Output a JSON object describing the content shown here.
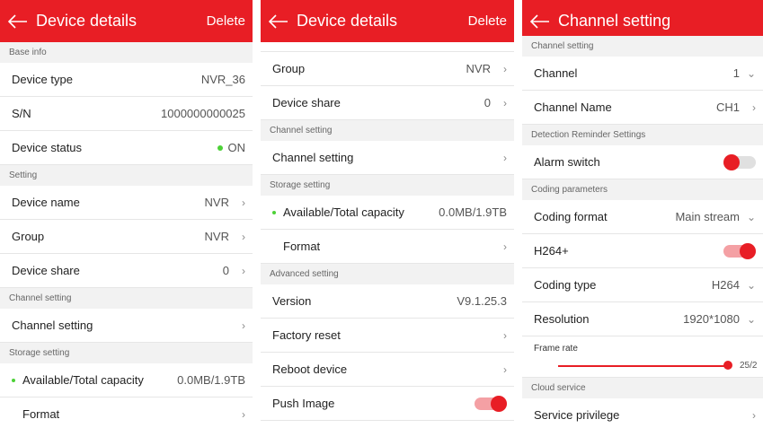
{
  "panel1": {
    "title": "Device details",
    "action": "Delete",
    "sections": {
      "base": "Base info",
      "setting": "Setting",
      "channel": "Channel setting",
      "storage": "Storage setting"
    },
    "device_type": {
      "label": "Device type",
      "value": "NVR_36"
    },
    "sn": {
      "label": "S/N",
      "value": "1000000000025"
    },
    "status": {
      "label": "Device status",
      "value": "ON"
    },
    "device_name": {
      "label": "Device name",
      "value": "NVR"
    },
    "group": {
      "label": "Group",
      "value": "NVR"
    },
    "share": {
      "label": "Device share",
      "value": "0"
    },
    "channel_setting": {
      "label": "Channel setting"
    },
    "capacity": {
      "label": "Available/Total capacity",
      "value": "0.0MB/1.9TB"
    },
    "format": {
      "label": "Format"
    }
  },
  "panel2": {
    "title": "Device details",
    "action": "Delete",
    "sections": {
      "channel": "Channel setting",
      "storage": "Storage setting",
      "advanced": "Advanced setting"
    },
    "group": {
      "label": "Group",
      "value": "NVR"
    },
    "share": {
      "label": "Device share",
      "value": "0"
    },
    "channel_setting": {
      "label": "Channel setting"
    },
    "capacity": {
      "label": "Available/Total capacity",
      "value": "0.0MB/1.9TB"
    },
    "format": {
      "label": "Format"
    },
    "version": {
      "label": "Version",
      "value": "V9.1.25.3"
    },
    "factory_reset": {
      "label": "Factory reset"
    },
    "reboot": {
      "label": "Reboot device"
    },
    "push_image": {
      "label": "Push Image",
      "on": true
    }
  },
  "panel3": {
    "title": "Channel setting",
    "sections": {
      "channel": "Channel setting",
      "detection": "Detection Reminder Settings",
      "coding": "Coding parameters",
      "cloud": "Cloud service"
    },
    "channel": {
      "label": "Channel",
      "value": "1"
    },
    "channel_name": {
      "label": "Channel Name",
      "value": "CH1"
    },
    "alarm": {
      "label": "Alarm switch",
      "on": false
    },
    "coding_format": {
      "label": "Coding format",
      "value": "Main stream"
    },
    "h264plus": {
      "label": "H264+",
      "on": true
    },
    "coding_type": {
      "label": "Coding type",
      "value": "H264"
    },
    "resolution": {
      "label": "Resolution",
      "value": "1920*1080"
    },
    "frame_rate": {
      "label": "Frame rate",
      "value": "25/2"
    },
    "service": {
      "label": "Service privilege"
    }
  },
  "colors": {
    "accent": "#e81e25",
    "online": "#4cd137"
  },
  "icons": {
    "back": "arrow-left-icon",
    "chevron_right": "chevron-right-icon",
    "chevron_down": "chevron-down-icon"
  }
}
